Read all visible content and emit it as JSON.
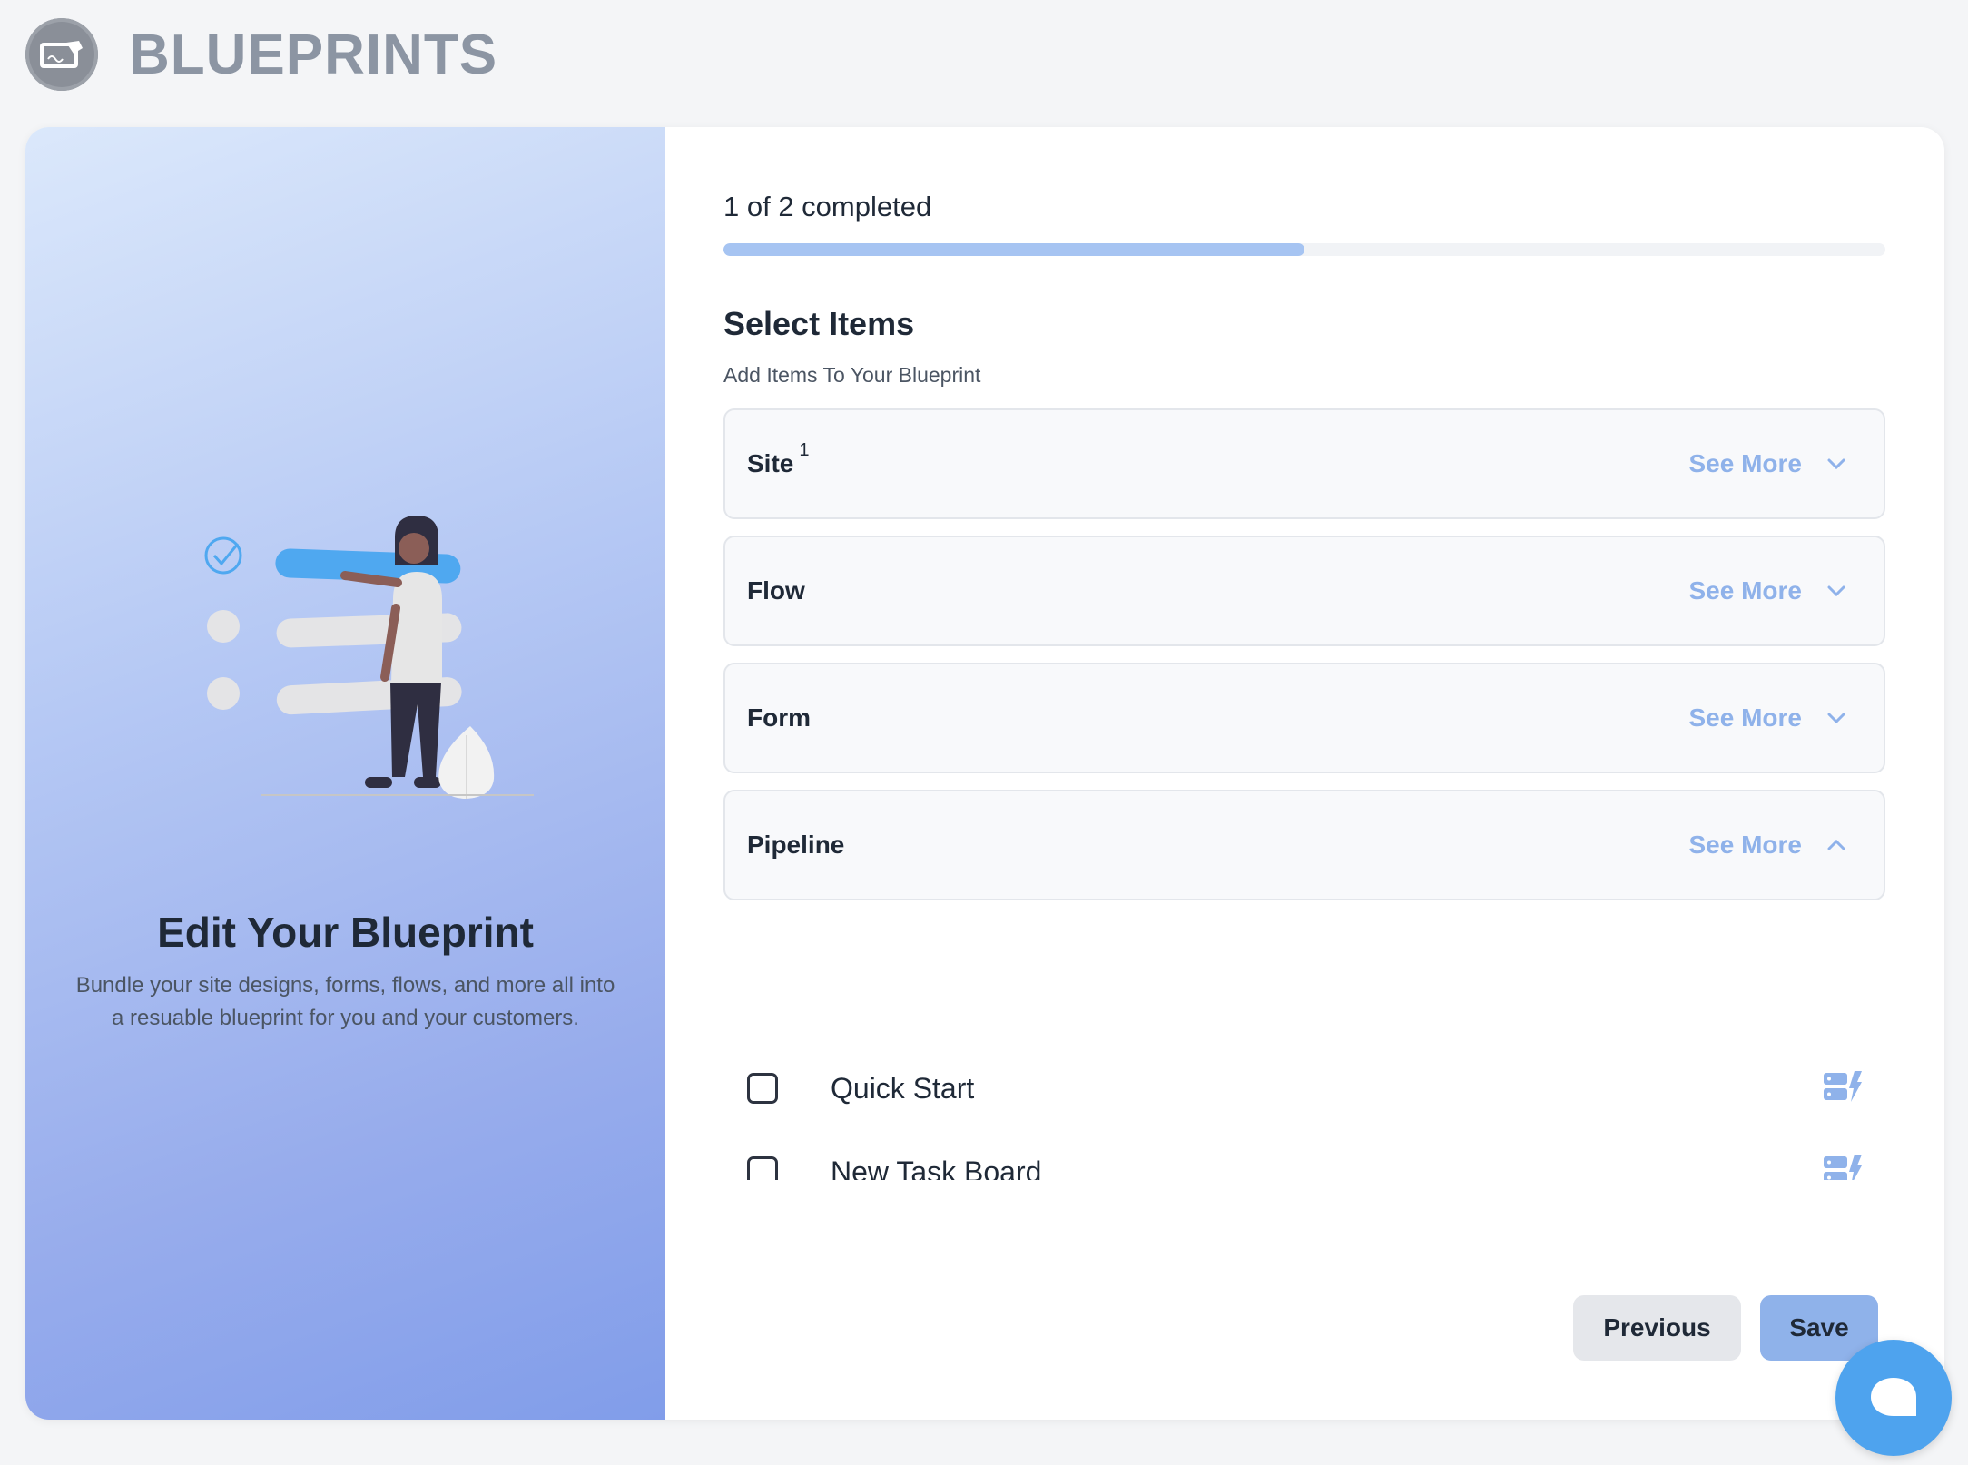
{
  "header": {
    "title": "BLUEPRINTS",
    "logo_icon": "blueprint-logo-icon"
  },
  "left": {
    "title": "Edit Your Blueprint",
    "description": "Bundle your site designs, forms, flows, and more all into a resuable blueprint for you and your customers."
  },
  "progress": {
    "text": "1 of 2 completed",
    "completed": 1,
    "total": 2,
    "fraction": 0.5
  },
  "section": {
    "title": "Select Items",
    "subtitle": "Add Items To Your Blueprint"
  },
  "accordions": [
    {
      "label": "Site",
      "badge": "1",
      "see_more": "See More",
      "expanded": false
    },
    {
      "label": "Flow",
      "see_more": "See More",
      "expanded": false
    },
    {
      "label": "Form",
      "see_more": "See More",
      "expanded": false
    },
    {
      "label": "Pipeline",
      "see_more": "See More",
      "expanded": true
    }
  ],
  "pipeline_items": [
    {
      "label": "Quick Start",
      "checked": false,
      "icon": "pipeline-icon"
    },
    {
      "label": "New Task Board",
      "checked": false,
      "icon": "pipeline-icon"
    }
  ],
  "buttons": {
    "previous": "Previous",
    "save": "Save"
  },
  "colors": {
    "accent": "#8fb2ea",
    "chat": "#4ea3ee",
    "title_gray": "#8c95a3"
  }
}
